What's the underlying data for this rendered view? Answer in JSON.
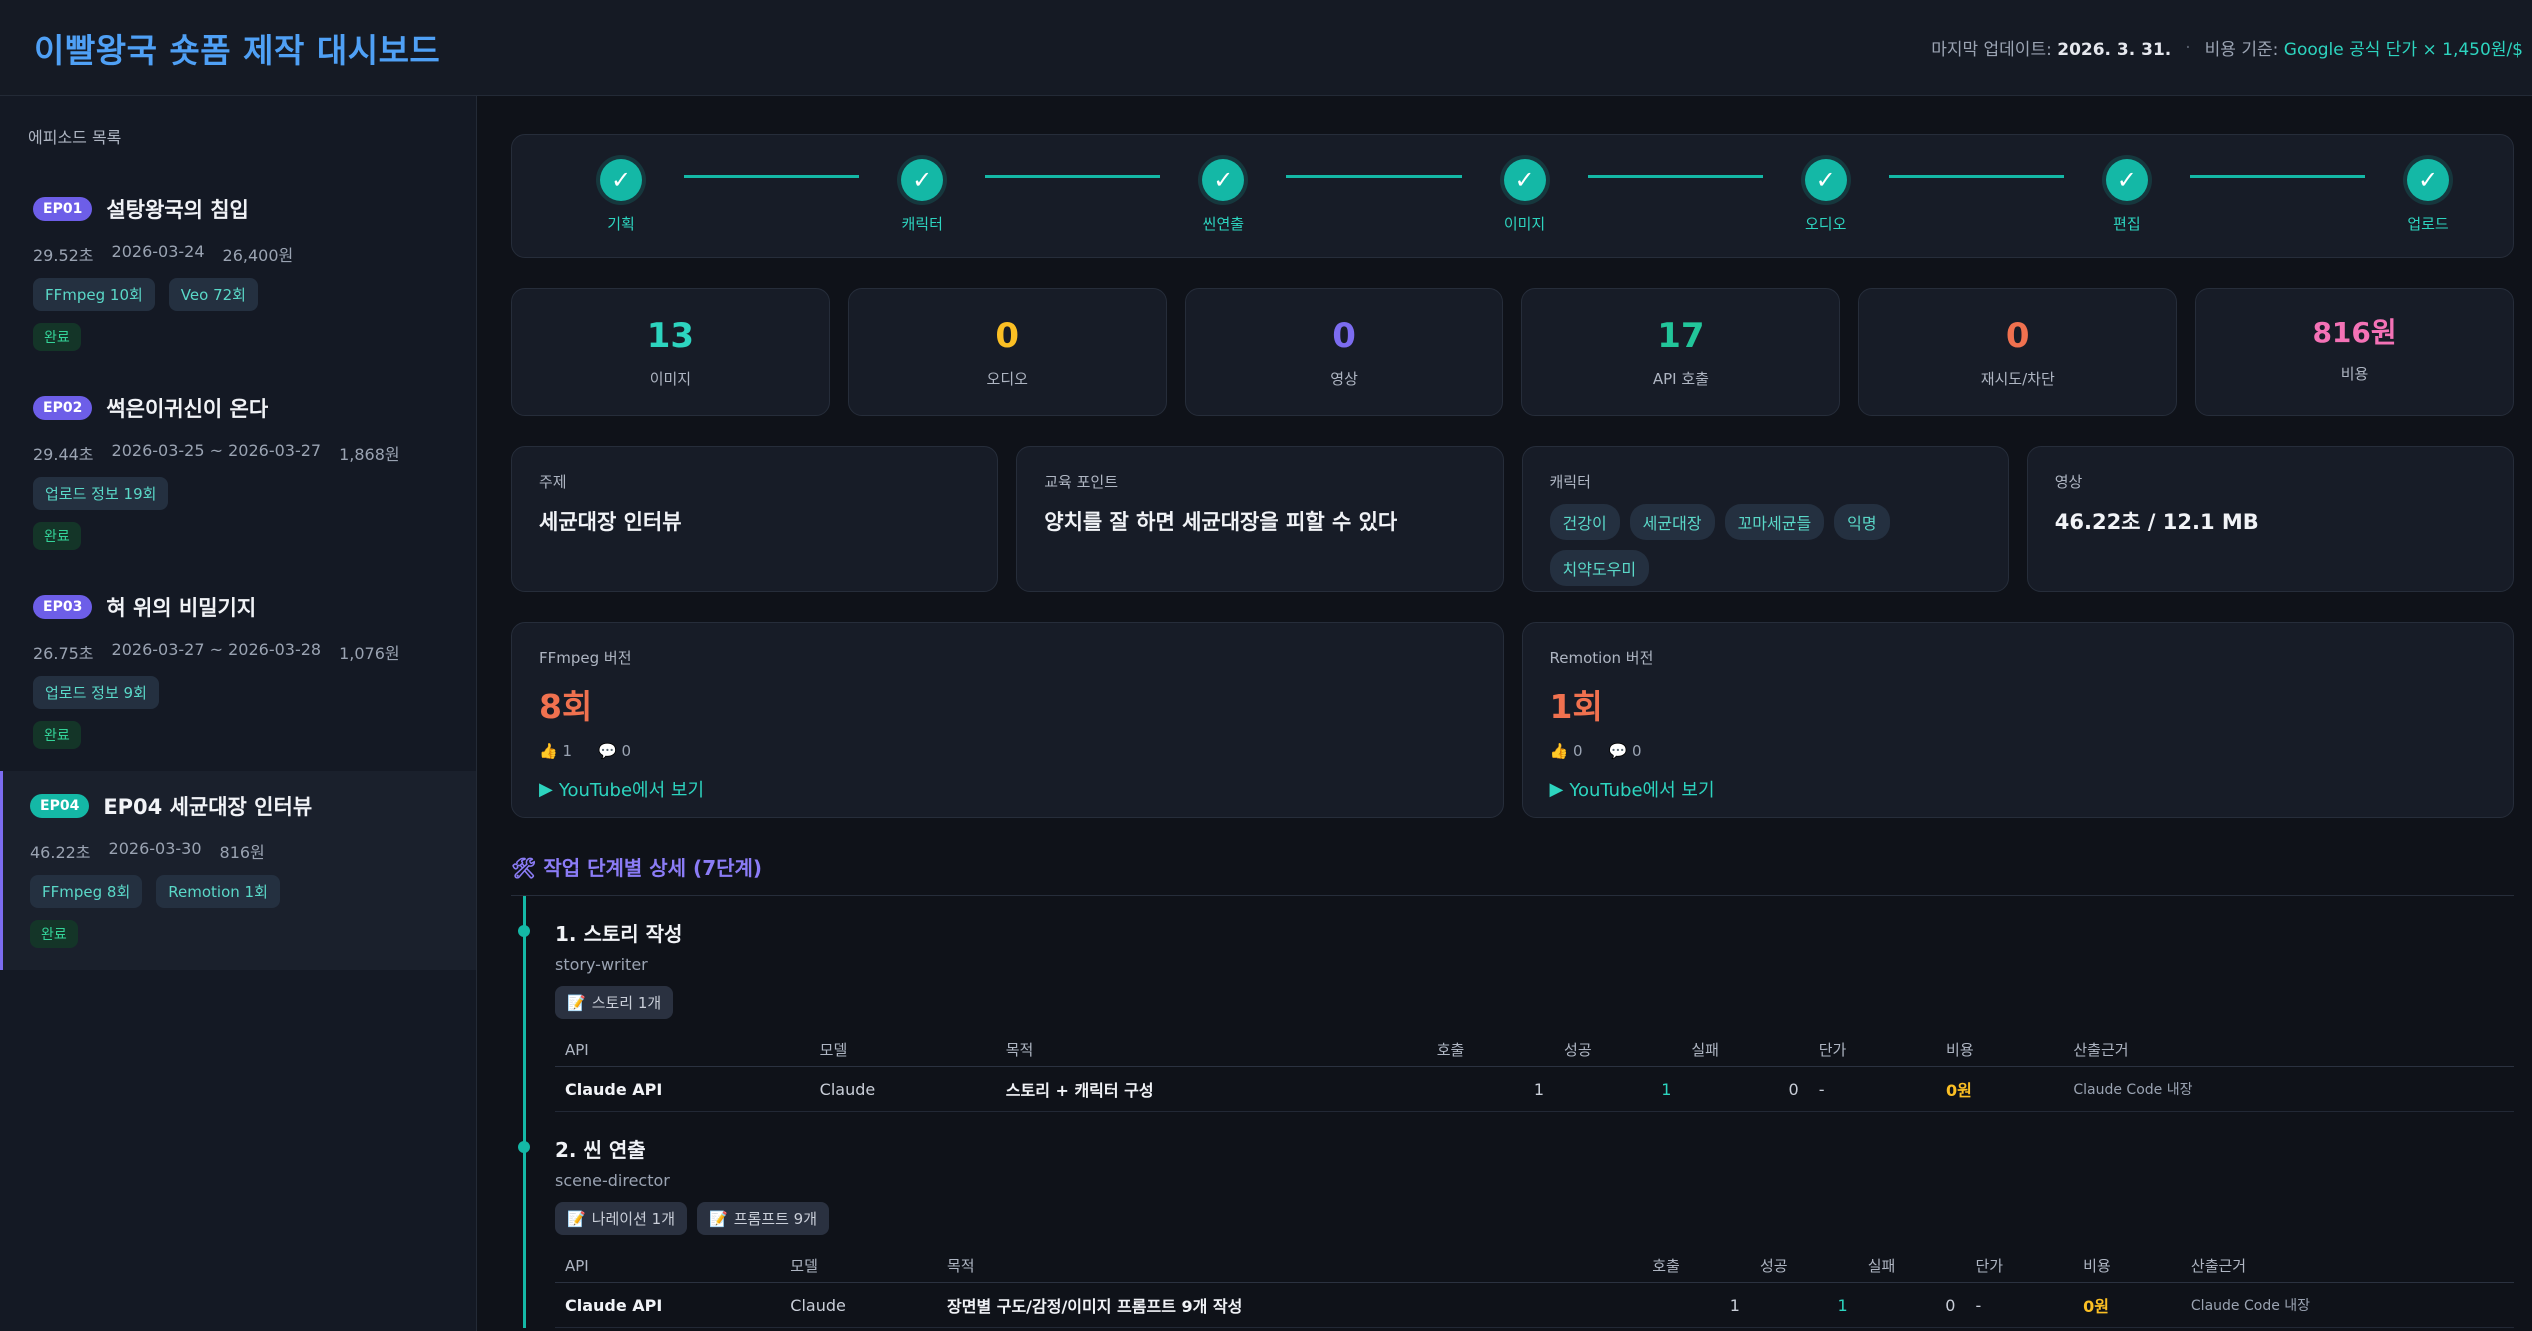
{
  "header": {
    "title": "이빨왕국 숏폼 제작 대시보드",
    "updated_label": "마지막 업데이트:",
    "updated_value": "2026. 3. 31.",
    "sep": "·",
    "cost_label": "비용 기준:",
    "cost_source": "Google 공식 단가",
    "cost_rate": "× 1,450원/$"
  },
  "sidebar": {
    "title": "에피소드 목록",
    "episodes": [
      {
        "badge": "EP01",
        "title": "설탕왕국의 침입",
        "duration": "29.52초",
        "date": "2026-03-24",
        "cost": "26,400원",
        "tags": [
          "FFmpeg 10회",
          "Veo 72회"
        ],
        "status": "완료"
      },
      {
        "badge": "EP02",
        "title": "썩은이귀신이 온다",
        "duration": "29.44초",
        "date": "2026-03-25 ~ 2026-03-27",
        "cost": "1,868원",
        "tags": [
          "업로드 정보 19회"
        ],
        "status": "완료"
      },
      {
        "badge": "EP03",
        "title": "혀 위의 비밀기지",
        "duration": "26.75초",
        "date": "2026-03-27 ~ 2026-03-28",
        "cost": "1,076원",
        "tags": [
          "업로드 정보 9회"
        ],
        "status": "완료"
      },
      {
        "badge": "EP04",
        "title": "EP04 세균대장 인터뷰",
        "duration": "46.22초",
        "date": "2026-03-30",
        "cost": "816원",
        "tags": [
          "FFmpeg 8회",
          "Remotion 1회"
        ],
        "status": "완료"
      }
    ]
  },
  "pipeline": {
    "steps": [
      "기획",
      "캐릭터",
      "씬연출",
      "이미지",
      "오디오",
      "편집",
      "업로드"
    ],
    "check": "✓"
  },
  "stats": [
    {
      "value": "13",
      "label": "이미지",
      "color": "#2dd4bf"
    },
    {
      "value": "0",
      "label": "오디오",
      "color": "#fbbf24"
    },
    {
      "value": "0",
      "label": "영상",
      "color": "#7c6cf0"
    },
    {
      "value": "17",
      "label": "API 호출",
      "color": "#22c59a"
    },
    {
      "value": "0",
      "label": "재시도/차단",
      "color": "#f0714f"
    },
    {
      "value": "816원",
      "label": "비용",
      "color": "#f472b6"
    }
  ],
  "info": {
    "topic_label": "주제",
    "topic_value": "세균대장 인터뷰",
    "edu_label": "교육 포인트",
    "edu_value": "양치를 잘 하면 세균대장을 피할 수 있다",
    "char_label": "캐릭터",
    "characters": [
      "건강이",
      "세균대장",
      "꼬마세균들",
      "익명",
      "치약도우미"
    ],
    "video_label": "영상",
    "video_value": "46.22초 / 12.1 MB"
  },
  "versions": [
    {
      "label": "FFmpeg 버전",
      "count": "8회",
      "likes": "1",
      "comments": "0",
      "link": "YouTube에서 보기"
    },
    {
      "label": "Remotion 버전",
      "count": "1회",
      "likes": "0",
      "comments": "0",
      "link": "YouTube에서 보기"
    }
  ],
  "detail": {
    "title": "작업 단계별 상세 (7단계)",
    "steps": [
      {
        "title": "1. 스토리 작성",
        "agent": "story-writer",
        "outputs": [
          "스토리 1개"
        ],
        "columns": [
          "API",
          "모델",
          "목적",
          "호출",
          "성공",
          "실패",
          "단가",
          "비용",
          "산출근거"
        ],
        "rows": [
          [
            "Claude API",
            "Claude",
            "스토리 + 캐릭터 구성",
            "1",
            "1",
            "0",
            "-",
            "0원",
            "Claude Code 내장"
          ]
        ]
      },
      {
        "title": "2. 씬 연출",
        "agent": "scene-director",
        "outputs": [
          "나레이션 1개",
          "프롬프트 9개"
        ],
        "columns": [
          "API",
          "모델",
          "목적",
          "호출",
          "성공",
          "실패",
          "단가",
          "비용",
          "산출근거"
        ],
        "rows": [
          [
            "Claude API",
            "Claude",
            "장면별 구도/감정/이미지 프롬프트 9개 작성",
            "1",
            "1",
            "0",
            "-",
            "0원",
            "Claude Code 내장"
          ]
        ]
      }
    ]
  }
}
